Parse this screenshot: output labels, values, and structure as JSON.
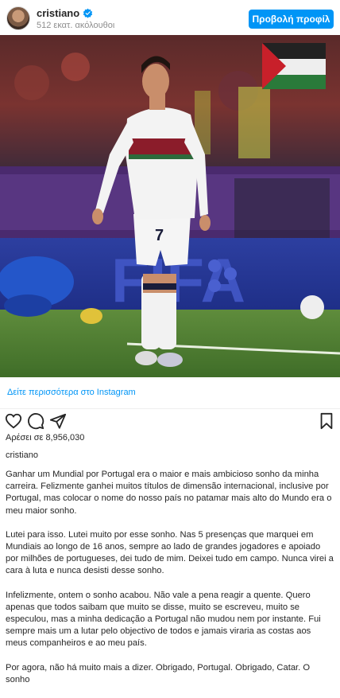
{
  "header": {
    "username": "cristiano",
    "followers": "512 εκατ. ακόλουθοι",
    "profile_button": "Προβολή προφίλ"
  },
  "photo": {
    "banner": "FIFA",
    "jersey_number": "7"
  },
  "more_link": "Δείτε περισσότερα στο Instagram",
  "actions": {
    "icons": [
      "heart-icon",
      "comment-icon",
      "share-icon",
      "bookmark-icon"
    ]
  },
  "likes": "Αρέσει σε 8,956,030",
  "caption": {
    "username": "cristiano",
    "paragraphs": [
      "Ganhar um Mundial por Portugal era o maior e mais ambicioso sonho da minha carreira. Felizmente ganhei muitos títulos de dimensão internacional, inclusive por Portugal, mas colocar o nome do nosso país no patamar mais alto do Mundo era o meu maior sonho.",
      "Lutei para isso. Lutei muito por esse sonho. Nas 5 presenças que marquei em Mundiais ao longo de 16 anos, sempre ao lado de grandes jogadores e apoiado por milhões de portugueses, dei tudo de mim. Deixei tudo em campo. Nunca virei a cara à luta e nunca desisti desse sonho.",
      "Infelizmente, ontem o sonho acabou. Não vale a pena reagir a quente. Quero apenas que todos saibam que muito se disse, muito se escreveu, muito se especulou, mas a minha dedicação a Portugal não mudou nem por instante. Fui sempre mais um a lutar pelo objectivo de todos e jamais viraria as costas aos meus companheiros e ao meu país.",
      "Por agora, não há muito mais a dizer. Obrigado, Portugal. Obrigado, Catar. O sonho"
    ]
  },
  "colors": {
    "accent": "#0095f6",
    "text": "#262626",
    "muted": "#8e8e8e"
  }
}
